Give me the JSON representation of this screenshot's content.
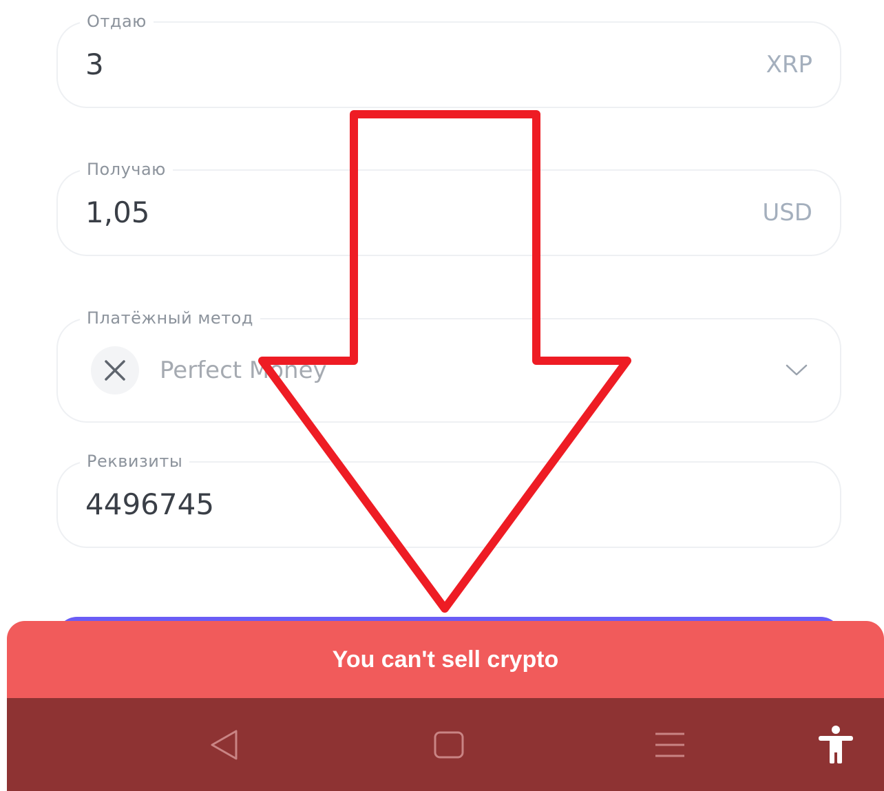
{
  "form": {
    "give": {
      "label": "Отдаю",
      "value": "3",
      "currency": "XRP"
    },
    "receive": {
      "label": "Получаю",
      "value": "1,05",
      "currency": "USD"
    },
    "payment_method": {
      "label": "Платёжный метод",
      "selected": "Perfect Money",
      "icon": "close-x-icon"
    },
    "details": {
      "label": "Реквизиты",
      "value": "4496745"
    }
  },
  "toast": {
    "message": "You can't sell crypto"
  },
  "nav_bar": {
    "icons": [
      "back-triangle-icon",
      "home-square-icon",
      "menu-lines-icon",
      "accessibility-icon"
    ]
  },
  "colors": {
    "toast_background": "#f15b5b",
    "nav_background": "#8e3333",
    "arrow_stroke": "#ee1c24",
    "submit_button": "#6a5cf5"
  }
}
